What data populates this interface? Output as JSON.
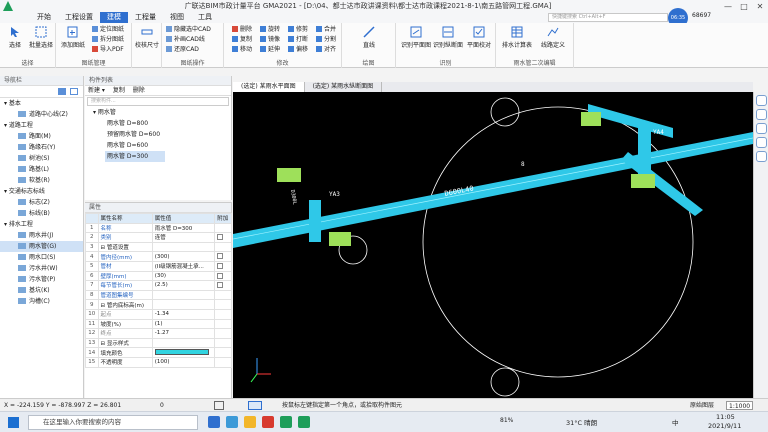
{
  "window": {
    "title": "广联达BIM市政计量平台 GMA2021 - [D:\\04、都士达市政讲课资料\\都士达市政课程2021-8-1\\南五路管网工程.GMA]",
    "controls": [
      "—",
      "□",
      "✕"
    ]
  },
  "menu": {
    "tabs": [
      "开始",
      "工程设置",
      "建模",
      "工程量",
      "视图",
      "工具"
    ],
    "active_index": 2,
    "search_placeholder": "快捷键搜索 Ctrl+Alt+F"
  },
  "user": {
    "time": "06:35",
    "id": "68697"
  },
  "ribbon": {
    "groups": [
      {
        "name": "选择",
        "buttons": [
          "选择",
          "批量选择"
        ]
      },
      {
        "name": "图纸管理",
        "buttons": [
          "添加图纸",
          "定位图纸",
          "拆分图纸",
          "导入PDF"
        ]
      },
      {
        "name": "",
        "buttons": [
          "校核尺寸"
        ]
      },
      {
        "name": "图纸操作",
        "buttons": [
          "隐藏选中CAD",
          "补画CAD线",
          "还原CAD"
        ]
      },
      {
        "name": "修改",
        "buttons": [
          "删除",
          "旋转",
          "修剪",
          "合并",
          "复制",
          "镜像",
          "打断",
          "分割",
          "移动",
          "延伸",
          "偏移",
          "对齐"
        ]
      },
      {
        "name": "绘图",
        "buttons": [
          "直线"
        ]
      },
      {
        "name": "识别",
        "buttons": [
          "识别平面图",
          "识别纵断面",
          "平面校对"
        ]
      },
      {
        "name": "雨水管二次编辑",
        "buttons": [
          "排水计算表",
          "线路定义"
        ]
      }
    ]
  },
  "nav": {
    "header": "导航栏",
    "items": [
      {
        "label": "基本",
        "type": "cat"
      },
      {
        "label": "道路中心线(Z)",
        "type": "sub"
      },
      {
        "label": "道路工程",
        "type": "cat"
      },
      {
        "label": "路面(M)",
        "type": "sub"
      },
      {
        "label": "路缘石(Y)",
        "type": "sub"
      },
      {
        "label": "树池(S)",
        "type": "sub"
      },
      {
        "label": "路基(L)",
        "type": "sub"
      },
      {
        "label": "软基(R)",
        "type": "sub"
      },
      {
        "label": "交通标志标线",
        "type": "cat"
      },
      {
        "label": "标志(Z)",
        "type": "sub"
      },
      {
        "label": "标线(B)",
        "type": "sub"
      },
      {
        "label": "排水工程",
        "type": "cat"
      },
      {
        "label": "雨水井(J)",
        "type": "sub"
      },
      {
        "label": "雨水管(G)",
        "type": "sub",
        "selected": true
      },
      {
        "label": "雨水口(S)",
        "type": "sub"
      },
      {
        "label": "污水井(W)",
        "type": "sub"
      },
      {
        "label": "污水管(P)",
        "type": "sub"
      },
      {
        "label": "基坑(K)",
        "type": "sub"
      },
      {
        "label": "沟槽(C)",
        "type": "sub"
      }
    ]
  },
  "component_list": {
    "header": "构件列表",
    "toolbar": [
      "新建 ▾",
      "复制",
      "删除"
    ],
    "search_placeholder": "搜索构件...",
    "root": "雨水管",
    "items": [
      "雨水管 D=800",
      "预留雨水管 D=600",
      "雨水管 D=600",
      "雨水管 D=300"
    ],
    "selected_index": 3
  },
  "properties": {
    "header": "属性",
    "columns": [
      "属性名称",
      "属性值",
      "附加"
    ],
    "rows": [
      {
        "n": "1",
        "name": "名称",
        "value": "雨水管 D=300",
        "style": "blue",
        "check": false
      },
      {
        "n": "2",
        "name": "类别",
        "value": "连管",
        "style": "blue",
        "check": true
      },
      {
        "n": "3",
        "name": "⊟ 管道设置",
        "value": "",
        "style": "",
        "check": false
      },
      {
        "n": "4",
        "name": "管内径(mm)",
        "value": "(300)",
        "style": "blue",
        "check": true
      },
      {
        "n": "5",
        "name": "管材",
        "value": "(II级钢筋混凝土承...",
        "style": "blue",
        "check": true
      },
      {
        "n": "6",
        "name": "壁厚(mm)",
        "value": "(30)",
        "style": "blue",
        "check": true
      },
      {
        "n": "7",
        "name": "每节管长(m)",
        "value": "(2.5)",
        "style": "blue",
        "check": true
      },
      {
        "n": "8",
        "name": "管道图集编号",
        "value": "",
        "style": "blue",
        "check": false
      },
      {
        "n": "9",
        "name": "⊟ 管内底标高(m)",
        "value": "",
        "style": "",
        "check": false
      },
      {
        "n": "10",
        "name": "起点",
        "value": "-1.34",
        "style": "grey",
        "check": false
      },
      {
        "n": "11",
        "name": "坡度(%)",
        "value": "(1)",
        "style": "",
        "check": false
      },
      {
        "n": "12",
        "name": "终点",
        "value": "-1.27",
        "style": "grey",
        "check": false
      },
      {
        "n": "13",
        "name": "⊟ 显示样式",
        "value": "",
        "style": "",
        "check": false
      },
      {
        "n": "14",
        "name": "填充颜色",
        "value": "",
        "style": "",
        "check": false,
        "swatch": "#31d4e0"
      },
      {
        "n": "15",
        "name": "不透明度",
        "value": "(100)",
        "style": "",
        "check": false
      }
    ]
  },
  "view_tabs": [
    "(选定) 某雨水平面图",
    "(选定) 某雨水纵断面图"
  ],
  "canvas": {
    "pipe_label_main": "D600L40",
    "pipe_label_side": "D300L",
    "well_labels": [
      "YA3",
      "YA4"
    ],
    "pipe_color": "#2fc8e8",
    "well_color": "#9ee05a",
    "circle_labels": [
      "8"
    ]
  },
  "status": {
    "coords": "X = -224.159 Y = -878.997 Z = 26.801",
    "zero": "0",
    "hint": "按鼠标左键指定第一个角点，或拾取构件图元",
    "view_label": "原始图层",
    "scale": "1:1000"
  },
  "taskbar": {
    "search": "在这里输入你要搜索的内容",
    "weather": "31°C 晴朗",
    "ime": "中",
    "time": "11:05",
    "date": "2021/9/11",
    "battery": "81%"
  }
}
